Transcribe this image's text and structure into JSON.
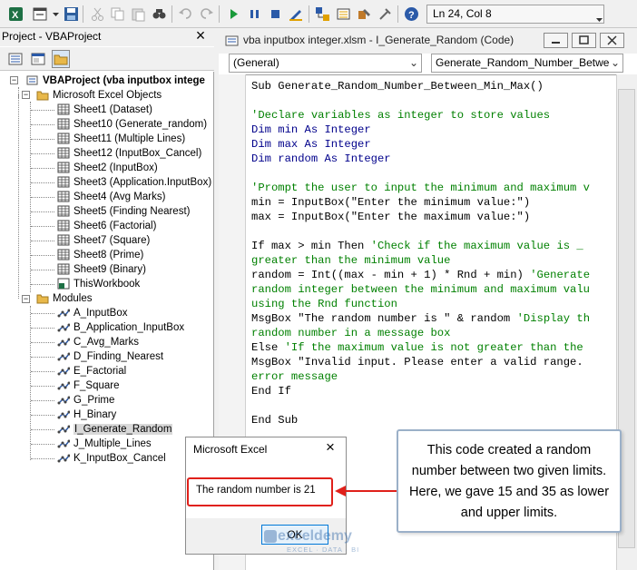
{
  "toolbar": {
    "position_text": "Ln 24, Col 8"
  },
  "project": {
    "title": "Project - VBAProject",
    "close_glyph": "×",
    "root": "VBAProject (vba inputbox intege",
    "folder_objects": "Microsoft Excel Objects",
    "sheets": [
      "Sheet1 (Dataset)",
      "Sheet10 (Generate_random)",
      "Sheet11 (Multiple Lines)",
      "Sheet12 (InputBox_Cancel)",
      "Sheet2 (InputBox)",
      "Sheet3 (Application.InputBox)",
      "Sheet4 (Avg Marks)",
      "Sheet5 (Finding Nearest)",
      "Sheet6 (Factorial)",
      "Sheet7 (Square)",
      "Sheet8 (Prime)",
      "Sheet9 (Binary)",
      "ThisWorkbook"
    ],
    "folder_modules": "Modules",
    "modules": [
      "A_InputBox",
      "B_Application_InputBox",
      "C_Avg_Marks",
      "D_Finding_Nearest",
      "E_Factorial",
      "F_Square",
      "G_Prime",
      "H_Binary",
      "I_Generate_Random",
      "J_Multiple_Lines",
      "K_InputBox_Cancel"
    ]
  },
  "code_window": {
    "title": "vba inputbox integer.xlsm - I_Generate_Random (Code)",
    "object_combo": "(General)",
    "proc_combo": "Generate_Random_Number_Betwe",
    "lines": [
      [
        {
          "t": "Sub Generate_Random_Number_Between_Min_Max()",
          "c": "tx"
        }
      ],
      [],
      [
        {
          "t": "'Declare variables as integer to store values",
          "c": "cm"
        }
      ],
      [
        {
          "t": "Dim min As Integer",
          "c": "kw"
        }
      ],
      [
        {
          "t": "Dim max As Integer",
          "c": "kw"
        }
      ],
      [
        {
          "t": "Dim random As Integer",
          "c": "kw"
        }
      ],
      [],
      [
        {
          "t": "'Prompt the user to input the minimum and maximum v",
          "c": "cm"
        }
      ],
      [
        {
          "t": "min = InputBox(\"Enter the minimum value:\")",
          "c": "tx"
        }
      ],
      [
        {
          "t": "max = InputBox(\"Enter the maximum value:\")",
          "c": "tx"
        }
      ],
      [],
      [
        {
          "t": "If max > min Then ",
          "c": "tx"
        },
        {
          "t": "'Check if the maximum value is _",
          "c": "cm"
        }
      ],
      [
        {
          "t": "greater than the minimum value",
          "c": "cm"
        }
      ],
      [
        {
          "t": "random = Int((max - min + 1) * Rnd + min) ",
          "c": "tx"
        },
        {
          "t": "'Generate",
          "c": "cm"
        }
      ],
      [
        {
          "t": "random integer between the minimum and maximum valu",
          "c": "cm"
        }
      ],
      [
        {
          "t": "using the Rnd function",
          "c": "cm"
        }
      ],
      [
        {
          "t": "MsgBox \"The random number is \" & random ",
          "c": "tx"
        },
        {
          "t": "'Display th",
          "c": "cm"
        }
      ],
      [
        {
          "t": "random number in a message box",
          "c": "cm"
        }
      ],
      [
        {
          "t": "Else ",
          "c": "tx"
        },
        {
          "t": "'If the maximum value is not greater than the",
          "c": "cm"
        }
      ],
      [
        {
          "t": "MsgBox \"Invalid input. Please enter a valid range.",
          "c": "tx"
        }
      ],
      [
        {
          "t": "error message",
          "c": "cm"
        }
      ],
      [
        {
          "t": "End If",
          "c": "tx"
        }
      ],
      [],
      [
        {
          "t": "End Sub",
          "c": "tx"
        }
      ]
    ]
  },
  "dialog": {
    "title": "Microsoft Excel",
    "close_glyph": "×",
    "message": "The random number is 21",
    "ok_label": "OK"
  },
  "callout": {
    "text": "This code created a random number between two given limits. Here, we gave 15 and 35 as lower and upper limits."
  },
  "watermark": {
    "name": "exceldemy",
    "tagline": "EXCEL · DATA · BI"
  },
  "colors": {
    "keyword": "#00008b",
    "comment": "#008000",
    "highlight": "#e0201a",
    "callout_border": "#9bb0c8"
  }
}
